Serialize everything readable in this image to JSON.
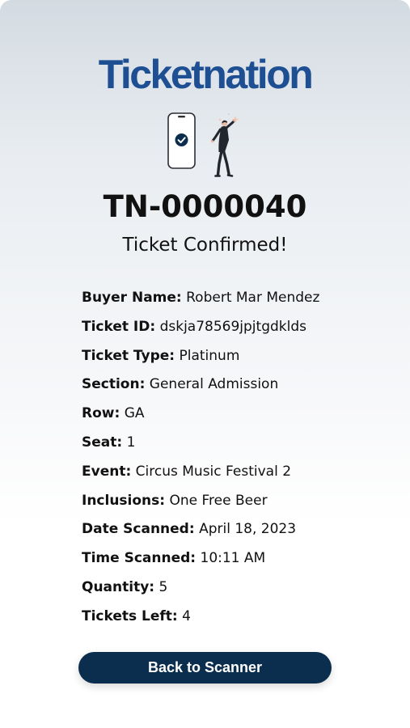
{
  "brand": {
    "logo_text": "Ticketnation",
    "color": "#1d4f92"
  },
  "illustration": {
    "icons": [
      "phone-check-icon",
      "celebrating-person-icon"
    ],
    "accent_color": "#0b2e4f"
  },
  "ticket": {
    "number": "TN-0000040",
    "status": "Ticket Confirmed!"
  },
  "details": [
    {
      "label": "Buyer Name:",
      "value": "Robert Mar Mendez"
    },
    {
      "label": "Ticket ID:",
      "value": "dskja78569jpjtgdklds"
    },
    {
      "label": "Ticket Type:",
      "value": "Platinum"
    },
    {
      "label": "Section:",
      "value": "General Admission"
    },
    {
      "label": "Row:",
      "value": "GA"
    },
    {
      "label": "Seat:",
      "value": "1"
    },
    {
      "label": "Event:",
      "value": "Circus Music Festival 2"
    },
    {
      "label": "Inclusions:",
      "value": "One Free Beer"
    },
    {
      "label": "Date Scanned:",
      "value": "April 18, 2023"
    },
    {
      "label": "Time Scanned:",
      "value": "10:11 AM"
    },
    {
      "label": "Quantity:",
      "value": "5"
    },
    {
      "label": "Tickets Left:",
      "value": "4"
    }
  ],
  "actions": {
    "back_label": "Back to Scanner",
    "button_color": "#0b2e4f"
  }
}
